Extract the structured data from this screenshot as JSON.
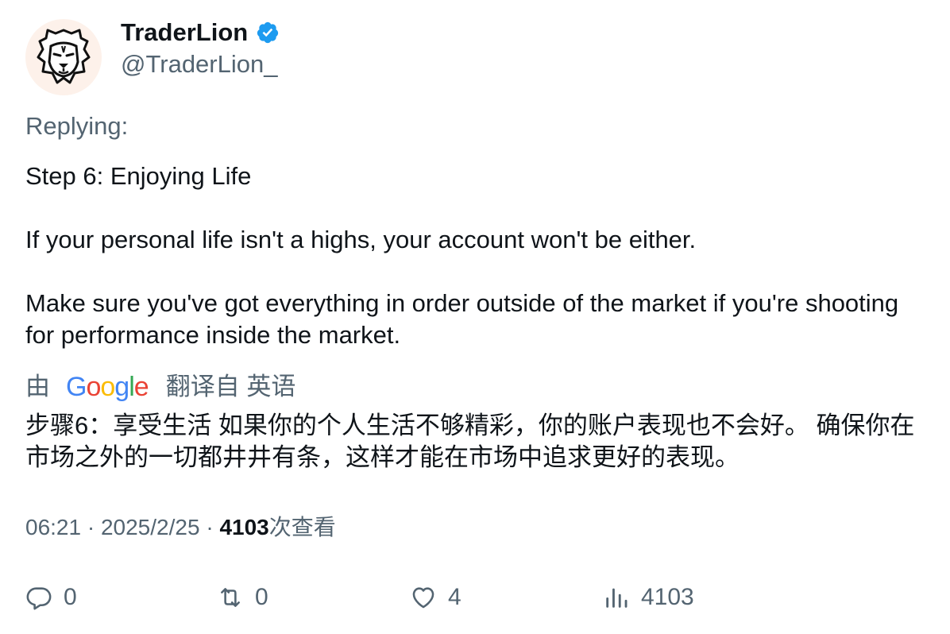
{
  "author": {
    "display_name": "TraderLion",
    "handle": "@TraderLion_",
    "verified": true,
    "avatar_icon": "lion-icon"
  },
  "replying_label": "Replying:",
  "tweet": {
    "paragraphs": [
      "Step 6: Enjoying Life",
      "If your personal life isn't a highs, your account won't be either.",
      "Make sure you've got everything in order outside of the market if you're shooting for performance inside the market."
    ]
  },
  "translation": {
    "prefix": "由",
    "provider": "Google",
    "suffix": "翻译自 英语",
    "text": "步骤6：享受生活 如果你的个人生活不够精彩，你的账户表现也不会好。 确保你在市场之外的一切都井井有条，这样才能在市场中追求更好的表现。"
  },
  "meta": {
    "time": "06:21",
    "date": "2025/2/25",
    "views_count": "4103",
    "views_label": "次查看"
  },
  "actions": {
    "replies": "0",
    "retweets": "0",
    "likes": "4",
    "views": "4103"
  },
  "colors": {
    "verified_blue": "#1d9bf0",
    "secondary_text": "#536471",
    "primary_text": "#0f1419"
  }
}
